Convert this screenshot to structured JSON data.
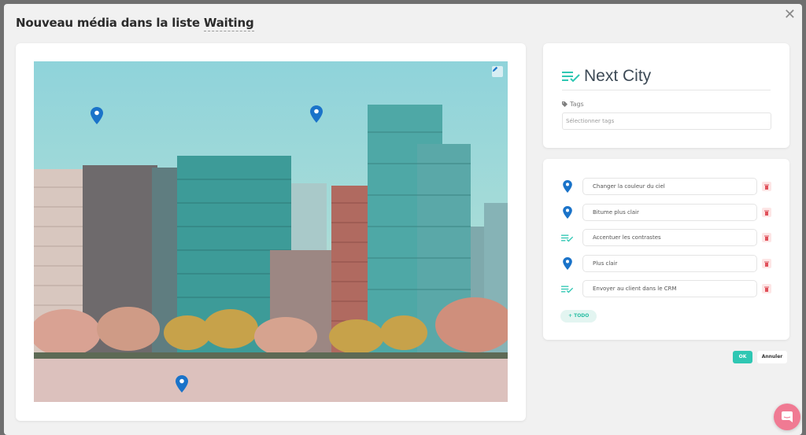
{
  "modal": {
    "title_prefix": "Nouveau média dans la liste",
    "list_name": "Waiting",
    "close_glyph": "✕"
  },
  "media": {
    "edit_icon": "pencil-icon",
    "pins": [
      {
        "icon": "location-pin-icon"
      },
      {
        "icon": "location-pin-icon"
      },
      {
        "icon": "location-pin-icon"
      }
    ]
  },
  "info": {
    "list_icon": "checklist-icon",
    "list_name": "Next City",
    "tags_label": "Tags",
    "tags_placeholder": "Sélectionner tags"
  },
  "todos": {
    "items": [
      {
        "type": "pin",
        "icon": "location-pin-icon",
        "text": "Changer la couleur du ciel"
      },
      {
        "type": "pin",
        "icon": "location-pin-icon",
        "text": "Bitume plus clair"
      },
      {
        "type": "list",
        "icon": "checklist-icon",
        "text": "Accentuer les contrastes"
      },
      {
        "type": "pin",
        "icon": "location-pin-icon",
        "text": "Plus clair"
      },
      {
        "type": "list",
        "icon": "checklist-icon",
        "text": "Envoyer au client dans le CRM"
      }
    ],
    "add_label": "+ TODO"
  },
  "actions": {
    "ok_label": "OK",
    "cancel_label": "Annuler"
  },
  "colors": {
    "accent": "#2fc7b3",
    "pin": "#1a73c9",
    "delete": "#e0505a",
    "chat": "#f07a93"
  }
}
